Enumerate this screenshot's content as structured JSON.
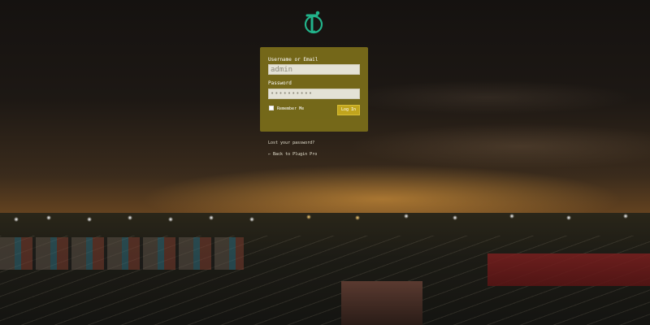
{
  "colors": {
    "panel": "#7c6f1a",
    "button": "#c1a51d",
    "logo": "#22b38a"
  },
  "logo": {
    "icon": "site-logo-icon"
  },
  "login": {
    "username_label": "Username or Email",
    "username_value": "admin",
    "password_label": "Password",
    "password_value": "••••••••••",
    "remember_label": "Remember Me",
    "remember_checked": false,
    "submit_label": "Log In"
  },
  "links": {
    "lost_password": "Lost your password?",
    "back_to_site": "← Back to Plugin Pro"
  }
}
